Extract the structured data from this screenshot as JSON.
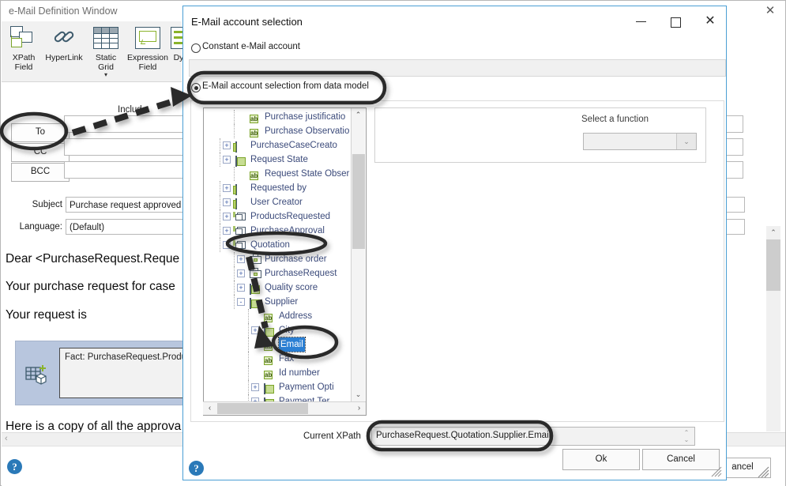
{
  "background_window": {
    "title": "e-Mail Definition Window",
    "close_icon": "✕",
    "toolbar": [
      {
        "label_line1": "XPath",
        "label_line2": "Field",
        "icon": "xpath-field-icon"
      },
      {
        "label_line1": "HyperLink",
        "label_line2": "",
        "icon": "hyperlink-icon"
      },
      {
        "label_line1": "Static",
        "label_line2": "Grid",
        "icon": "static-grid-icon"
      },
      {
        "label_line1": "Expression",
        "label_line2": "Field",
        "icon": "expression-field-icon"
      },
      {
        "label_line1": "Dy",
        "label_line2": "",
        "icon": "dynamic-grid-icon"
      }
    ],
    "include_label": "Include",
    "address_buttons": [
      "To",
      "CC",
      "BCC"
    ],
    "subject_label": "Subject",
    "subject_value": "Purchase request approved",
    "language_label": "Language:",
    "language_value": "(Default)",
    "body_lines": [
      "Dear <PurchaseRequest.Reque",
      "Your purchase request for case",
      "Your request is"
    ],
    "fact_box_text": "Fact: PurchaseRequest.Produ",
    "footer_line": "Here is a copy of all the approva",
    "hscroll_left_arrow": "‹",
    "help_icon_label": "?",
    "cancel_label": "ancel"
  },
  "dialog": {
    "title": "E-Mail account selection",
    "window_buttons": {
      "minimize": "—",
      "maximize": "❐",
      "close": "✕"
    },
    "radio_constant": {
      "label": "Constant e-Mail account",
      "selected": false
    },
    "radio_from_model": {
      "label": "E-Mail account selection from data model",
      "selected": true
    },
    "constant_field_value": "",
    "function_panel": {
      "label": "Select a function",
      "combo_value": "",
      "combo_arrow": "⌄"
    },
    "tree": {
      "nodes": [
        {
          "label": "Purchase justificatio",
          "icon": "attribute-ab-icon",
          "depth": 2,
          "expander": "",
          "selected": false
        },
        {
          "label": "Purchase Observatio",
          "icon": "attribute-ab-icon",
          "depth": 2,
          "expander": "",
          "selected": false
        },
        {
          "label": "PurchaseCaseCreato",
          "icon": "entity-icon",
          "depth": 1,
          "expander": "+",
          "selected": false
        },
        {
          "label": "Request State",
          "icon": "list-icon",
          "depth": 1,
          "expander": "+",
          "selected": false
        },
        {
          "label": "Request State Obser",
          "icon": "attribute-ab-icon",
          "depth": 2,
          "expander": "",
          "selected": false
        },
        {
          "label": "Requested by",
          "icon": "entity-icon",
          "depth": 1,
          "expander": "+",
          "selected": false
        },
        {
          "label": "User Creator",
          "icon": "entity-icon",
          "depth": 1,
          "expander": "+",
          "selected": false
        },
        {
          "label": "ProductsRequested",
          "icon": "relation-icon",
          "depth": 1,
          "expander": "+",
          "selected": false
        },
        {
          "label": "PurchaseApproval",
          "icon": "relation-icon",
          "depth": 1,
          "expander": "+",
          "selected": false
        },
        {
          "label": "Quotation",
          "icon": "relation-icon",
          "depth": 1,
          "expander": "-",
          "selected": false
        },
        {
          "label": "Purchase order",
          "icon": "case-icon",
          "depth": 2,
          "expander": "+",
          "selected": false
        },
        {
          "label": "PurchaseRequest",
          "icon": "case-icon",
          "depth": 2,
          "expander": "+",
          "selected": false
        },
        {
          "label": "Quality score",
          "icon": "list-icon",
          "depth": 2,
          "expander": "+",
          "selected": false
        },
        {
          "label": "Supplier",
          "icon": "list-icon",
          "depth": 2,
          "expander": "-",
          "selected": false
        },
        {
          "label": "Address",
          "icon": "attribute-ab-icon",
          "depth": 3,
          "expander": "",
          "selected": false
        },
        {
          "label": "City",
          "icon": "list-icon",
          "depth": 3,
          "expander": "+",
          "selected": false
        },
        {
          "label": "Email",
          "icon": "attribute-ab-icon",
          "depth": 3,
          "expander": "",
          "selected": true
        },
        {
          "label": "Fax",
          "icon": "attribute-ab-icon",
          "depth": 3,
          "expander": "",
          "selected": false
        },
        {
          "label": "Id number",
          "icon": "attribute-ab-icon",
          "depth": 3,
          "expander": "",
          "selected": false
        },
        {
          "label": "Payment Opti",
          "icon": "list-icon",
          "depth": 3,
          "expander": "+",
          "selected": false
        },
        {
          "label": "Payment Ter",
          "icon": "list-icon",
          "depth": 3,
          "expander": "+",
          "selected": false
        }
      ],
      "vscroll_up": "⌃",
      "vscroll_down": "⌄",
      "hscroll_left": "‹",
      "hscroll_right": "›"
    },
    "xpath_label": "Current XPath",
    "xpath_value": "PurchaseRequest.Quotation.Supplier.Email",
    "ok_label": "Ok",
    "cancel_label": "Cancel",
    "help_icon_label": "?"
  },
  "annotations": {
    "highlight_ovals": [
      "To button",
      "E-Mail account selection from data model radio",
      "Quotation tree node",
      "Email tree node",
      "Current XPath value"
    ],
    "arrows": [
      "To button to dialog radio",
      "Quotation node to Email node"
    ]
  },
  "colors": {
    "dialog_border": "#4a9fd4",
    "selection_blue": "#2a7fd4",
    "annotation_black": "#2b2b2b",
    "help_blue": "#2a79b8",
    "tree_text": "#3b4a7a",
    "icon_green": "#7ba428"
  }
}
